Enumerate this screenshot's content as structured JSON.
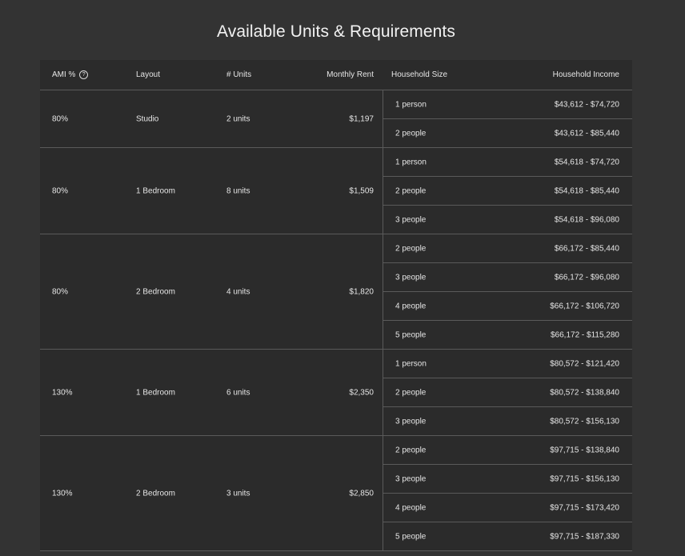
{
  "page": {
    "title": "Available Units & Requirements"
  },
  "table": {
    "headers": {
      "ami": "AMI %",
      "help_icon": "?",
      "layout": "Layout",
      "units": "# Units",
      "rent": "Monthly Rent",
      "household_size": "Household Size",
      "household_income": "Household Income"
    },
    "groups": [
      {
        "ami": "80%",
        "layout": "Studio",
        "units": "2 units",
        "rent": "$1,197",
        "rows": [
          {
            "size": "1 person",
            "income": "$43,612 - $74,720"
          },
          {
            "size": "2 people",
            "income": "$43,612 - $85,440"
          }
        ]
      },
      {
        "ami": "80%",
        "layout": "1 Bedroom",
        "units": "8 units",
        "rent": "$1,509",
        "rows": [
          {
            "size": "1 person",
            "income": "$54,618 - $74,720"
          },
          {
            "size": "2 people",
            "income": "$54,618 - $85,440"
          },
          {
            "size": "3 people",
            "income": "$54,618 - $96,080"
          }
        ]
      },
      {
        "ami": "80%",
        "layout": "2 Bedroom",
        "units": "4 units",
        "rent": "$1,820",
        "rows": [
          {
            "size": "2 people",
            "income": "$66,172 - $85,440"
          },
          {
            "size": "3 people",
            "income": "$66,172 - $96,080"
          },
          {
            "size": "4 people",
            "income": "$66,172 - $106,720"
          },
          {
            "size": "5 people",
            "income": "$66,172 - $115,280"
          }
        ]
      },
      {
        "ami": "130%",
        "layout": "1 Bedroom",
        "units": "6 units",
        "rent": "$2,350",
        "rows": [
          {
            "size": "1 person",
            "income": "$80,572 - $121,420"
          },
          {
            "size": "2 people",
            "income": "$80,572 - $138,840"
          },
          {
            "size": "3 people",
            "income": "$80,572 - $156,130"
          }
        ]
      },
      {
        "ami": "130%",
        "layout": "2 Bedroom",
        "units": "3 units",
        "rent": "$2,850",
        "rows": [
          {
            "size": "2 people",
            "income": "$97,715 - $138,840"
          },
          {
            "size": "3 people",
            "income": "$97,715 - $156,130"
          },
          {
            "size": "4 people",
            "income": "$97,715 - $173,420"
          },
          {
            "size": "5 people",
            "income": "$97,715 - $187,330"
          }
        ]
      }
    ]
  }
}
